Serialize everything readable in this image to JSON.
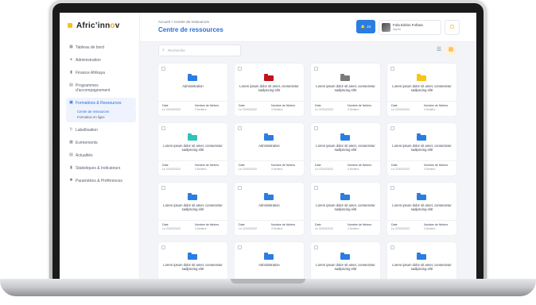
{
  "app": {
    "logo_prefix": "Afric",
    "logo_accent": "’",
    "logo_suffix": "inn",
    "logo_o": "o",
    "logo_tail": "v"
  },
  "sidebar": {
    "items": [
      {
        "label": "Tableau de bord",
        "icon": "grid-icon"
      },
      {
        "label": "Administration",
        "icon": "user-icon"
      },
      {
        "label": "Finance Afrikaya",
        "icon": "bar-chart-icon"
      },
      {
        "label": "Programmes d'accompagnement",
        "icon": "document-icon"
      },
      {
        "label": "Formations & Ressources",
        "icon": "book-icon",
        "active": true
      },
      {
        "label": "Labellisation",
        "icon": "refresh-icon"
      },
      {
        "label": "Evènements",
        "icon": "calendar-icon"
      },
      {
        "label": "Actualités",
        "icon": "news-icon"
      },
      {
        "label": "Statistiques & Indicateurs",
        "icon": "stats-icon"
      },
      {
        "label": "Paramètres & Préférences",
        "icon": "settings-icon"
      }
    ],
    "subitems": [
      {
        "label": "Centre de ressources",
        "active": true
      },
      {
        "label": "Formation en ligne",
        "active": false
      }
    ]
  },
  "header": {
    "breadcrumb": "Accueil  >  Centre de ressources",
    "title": "Centre de ressources",
    "notif_count": "24",
    "user_name": "Fola Edriss Fofana",
    "user_role": "Admin",
    "colors": {
      "accent": "#2a7de1",
      "brand": "#f5a623"
    }
  },
  "toolbar": {
    "search_placeholder": "Recherche"
  },
  "footer_labels": {
    "date": "Date",
    "files": "Nombre de fichiers"
  },
  "cards": [
    {
      "color": "#2a7de1",
      "title": "Administration",
      "date": "Le 22/03/2022",
      "files": "3 fichiers"
    },
    {
      "color": "#c0141c",
      "title": "Lorem ipsum dolor sit amet, consectetur sadipscing elitr",
      "date": "Le 22/03/2022",
      "files": "3 fichiers"
    },
    {
      "color": "#7a7a7a",
      "title": "Lorem ipsum dolor sit amet, consectetur sadipscing elitr",
      "date": "Le 22/03/2022",
      "files": "3 fichiers"
    },
    {
      "color": "#f5c518",
      "title": "Lorem ipsum dolor sit amet, consectetur sadipscing elitr",
      "date": "Le 22/03/2022",
      "files": "3 fichiers"
    },
    {
      "color": "#2ec4b6",
      "title": "Lorem ipsum dolor sit amet, consectetur sadipscing elitr",
      "date": "Le 22/03/2022",
      "files": "3 fichiers"
    },
    {
      "color": "#2a7de1",
      "title": "Administration",
      "date": "Le 22/03/2022",
      "files": "3 fichiers"
    },
    {
      "color": "#2a7de1",
      "title": "Lorem ipsum dolor sit amet, consectetur sadipscing elitr",
      "date": "Le 22/03/2022",
      "files": "3 fichiers"
    },
    {
      "color": "#2a7de1",
      "title": "Lorem ipsum dolor sit amet, consectetur sadipscing elitr",
      "date": "Le 22/03/2022",
      "files": "3 fichiers"
    },
    {
      "color": "#2a7de1",
      "title": "Lorem ipsum dolor sit amet, consectetur sadipscing elitr",
      "date": "Le 22/03/2022",
      "files": "3 fichiers"
    },
    {
      "color": "#2a7de1",
      "title": "Administration",
      "date": "Le 22/03/2022",
      "files": "3 fichiers"
    },
    {
      "color": "#2a7de1",
      "title": "Lorem ipsum dolor sit amet, consectetur sadipscing elitr",
      "date": "Le 22/03/2022",
      "files": "3 fichiers"
    },
    {
      "color": "#2a7de1",
      "title": "Lorem ipsum dolor sit amet, consectetur sadipscing elitr",
      "date": "Le 22/03/2022",
      "files": "3 fichiers"
    },
    {
      "color": "#2a7de1",
      "title": "Lorem ipsum dolor sit amet, consectetur sadipscing elitr",
      "date": "",
      "files": ""
    },
    {
      "color": "#2a7de1",
      "title": "Administration",
      "date": "",
      "files": ""
    },
    {
      "color": "#2a7de1",
      "title": "Lorem ipsum dolor sit amet, consectetur sadipscing elitr",
      "date": "",
      "files": ""
    },
    {
      "color": "#2a7de1",
      "title": "Lorem ipsum dolor sit amet, consectetur sadipscing elitr",
      "date": "",
      "files": ""
    }
  ]
}
